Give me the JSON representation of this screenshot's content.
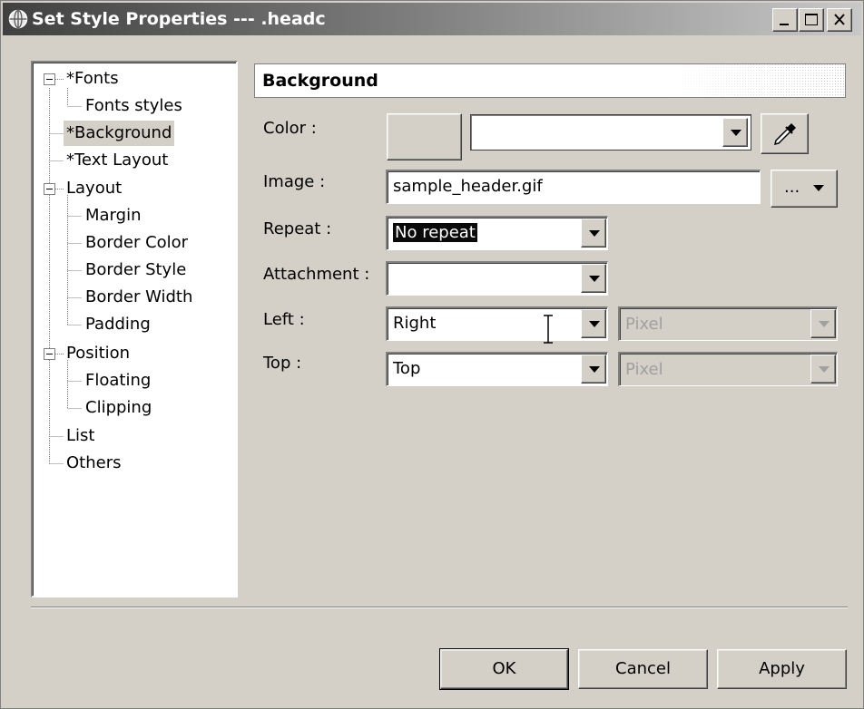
{
  "window": {
    "title": "Set Style Properties --- .headc",
    "minimize_icon": "minimize-icon",
    "maximize_icon": "maximize-icon",
    "close_icon": "close-icon"
  },
  "tree": {
    "items": [
      {
        "label": "*Fonts",
        "expanded": true
      },
      {
        "label": "Fonts styles"
      },
      {
        "label": "*Background",
        "selected": true
      },
      {
        "label": "*Text Layout"
      },
      {
        "label": "Layout",
        "expanded": true
      },
      {
        "label": "Margin"
      },
      {
        "label": "Border Color"
      },
      {
        "label": "Border Style"
      },
      {
        "label": "Border Width"
      },
      {
        "label": "Padding"
      },
      {
        "label": "Position",
        "expanded": true
      },
      {
        "label": "Floating"
      },
      {
        "label": "Clipping"
      },
      {
        "label": "List"
      },
      {
        "label": "Others"
      }
    ]
  },
  "section": {
    "title": "Background"
  },
  "form": {
    "color_label": "Color :",
    "color_value": "",
    "image_label": "Image :",
    "image_value": "sample_header.gif",
    "image_browse_label": "...",
    "repeat_label": "Repeat :",
    "repeat_value": "No repeat",
    "attachment_label": "Attachment :",
    "attachment_value": "",
    "left_label": "Left :",
    "left_value": "Right",
    "left_unit": "Pixel",
    "top_label": "Top :",
    "top_value": "Top",
    "top_unit": "Pixel"
  },
  "buttons": {
    "ok": "OK",
    "cancel": "Cancel",
    "apply": "Apply"
  },
  "colors": {
    "dialog_bg": "#d4d0c8",
    "selection": "#0a0a0a"
  }
}
